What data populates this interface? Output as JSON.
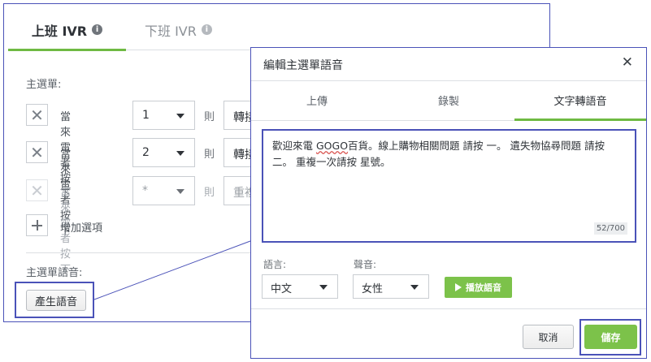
{
  "ivr_tabs": [
    {
      "label": "上班 IVR",
      "info_icon": "info-icon",
      "active": true
    },
    {
      "label": "下班 IVR",
      "info_icon": "info-icon",
      "active": false
    }
  ],
  "main_menu": {
    "label": "主選單:",
    "rows": [
      {
        "remove_icon": "close-icon",
        "text": "當來電者按下",
        "key": "1",
        "then": "則",
        "action": "轉接",
        "disabled": false
      },
      {
        "remove_icon": "close-icon",
        "text": "當來電者按下",
        "key": "2",
        "then": "則",
        "action": "轉接",
        "disabled": false
      },
      {
        "remove_icon": "close-icon",
        "text": "當來電者按下",
        "key": "*",
        "then": "則",
        "action": "重複",
        "disabled": true
      }
    ],
    "add_option": {
      "icon": "plus-icon",
      "label": "增加選項"
    }
  },
  "voice_section": {
    "label": "主選單語音:",
    "generate_button": "產生語音"
  },
  "modal": {
    "title": "編輯主選單語音",
    "close_icon": "close-icon",
    "tabs": [
      "上傳",
      "錄製",
      "文字轉語音"
    ],
    "active_tab": "文字轉語音",
    "tts": {
      "text_before": "歡迎來電 ",
      "text_misspelled": "GOGO",
      "text_after": "百貨。線上購物相關問題 請按 一。 遺失物協尋問題 請按 二。 重複一次請按 星號。",
      "char_count": "52/700"
    },
    "language": {
      "label": "語言:",
      "value": "中文"
    },
    "voice": {
      "label": "聲音:",
      "value": "女性"
    },
    "play_button": "播放語音",
    "cancel_button": "取消",
    "save_button": "儲存"
  },
  "colors": {
    "accent_green": "#7cc24a",
    "tab_underline": "#6fba43",
    "highlight_frame": "#4a52b8"
  }
}
